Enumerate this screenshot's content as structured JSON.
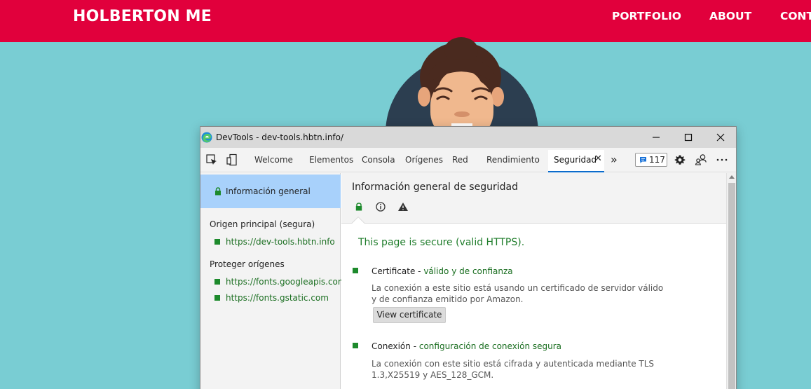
{
  "site": {
    "logo": "HOLBERTON ME",
    "nav": [
      "PORTFOLIO",
      "ABOUT",
      "CONT"
    ]
  },
  "devtools": {
    "window_title": "DevTools - dev-tools.hbtn.info/",
    "tabs": [
      "Welcome",
      "Elementos",
      "Consola",
      "Orígenes",
      "Red",
      "Rendimiento"
    ],
    "active_tab": "Seguridad",
    "more_tabs": "»",
    "issues_count": "117",
    "sidebar": {
      "active_item": "Información general",
      "main_origin_heading": "Origen principal (segura)",
      "main_origin": "https://dev-tools.hbtn.info",
      "secure_origins_heading": "Proteger orígenes",
      "secure_origins": [
        "https://fonts.googleapis.com",
        "https://fonts.gstatic.com"
      ]
    },
    "main": {
      "title": "Información general de seguridad",
      "secure_message": "This page is secure (valid HTTPS).",
      "certificate": {
        "label": "Certificate",
        "separator": " - ",
        "status": "válido y de confianza",
        "description": "La conexión a este sitio está usando un certificado de servidor válido y de confianza emitido por Amazon.",
        "button": "View certificate"
      },
      "connection": {
        "label": "Conexión",
        "separator": " - ",
        "status": "configuración de conexión segura",
        "description": "La conexión con este sitio está cifrada y autenticada mediante TLS 1.3,X25519 y AES_128_GCM."
      }
    },
    "colors": {
      "secure_green": "#1d8a2c",
      "active_sidebar": "#a8d1fb",
      "header_red": "#e1003c",
      "page_bg": "#79cdd3"
    }
  }
}
